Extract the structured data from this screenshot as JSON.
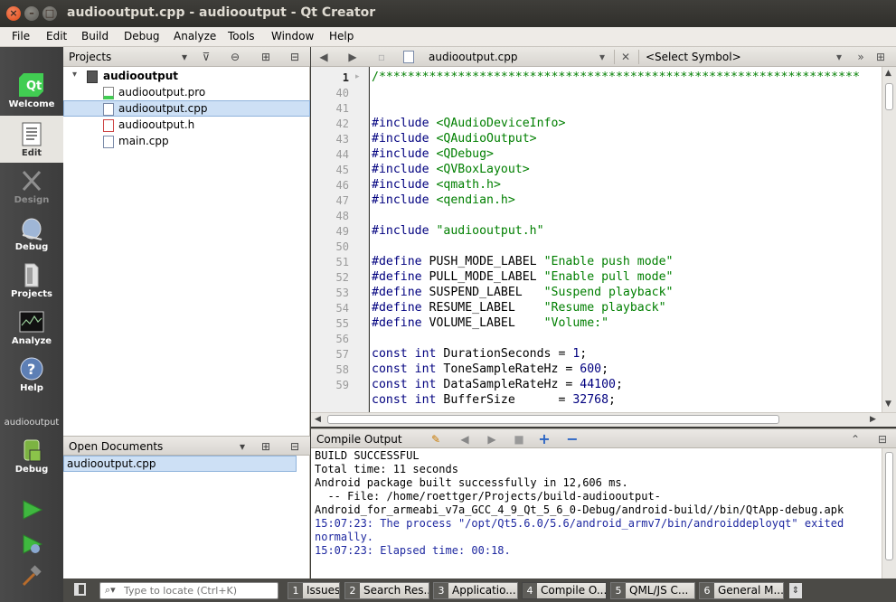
{
  "window": {
    "title": "audiooutput.cpp - audiooutput - Qt Creator",
    "close_glyph": "×",
    "minimize_glyph": "–",
    "maximize_glyph": "□"
  },
  "menu": [
    "File",
    "Edit",
    "Build",
    "Debug",
    "Analyze",
    "Tools",
    "Window",
    "Help"
  ],
  "modes": [
    {
      "label": "Welcome",
      "icon": "qt-logo-icon",
      "state": "normal"
    },
    {
      "label": "Edit",
      "icon": "edit-document-icon",
      "state": "active"
    },
    {
      "label": "Design",
      "icon": "design-icon",
      "state": "disabled"
    },
    {
      "label": "Debug",
      "icon": "debug-bug-icon",
      "state": "normal"
    },
    {
      "label": "Projects",
      "icon": "projects-icon",
      "state": "normal"
    },
    {
      "label": "Analyze",
      "icon": "analyze-icon",
      "state": "normal"
    },
    {
      "label": "Help",
      "icon": "help-icon",
      "state": "normal"
    }
  ],
  "kit": {
    "project": "audiooutput",
    "build_config": "Debug"
  },
  "projects_pane": {
    "title": "Projects",
    "root": "audiooutput",
    "files": [
      {
        "name": "audiooutput.pro",
        "type": "pro"
      },
      {
        "name": "audiooutput.cpp",
        "type": "cpp",
        "selected": true
      },
      {
        "name": "audiooutput.h",
        "type": "h"
      },
      {
        "name": "main.cpp",
        "type": "cpp"
      }
    ]
  },
  "open_documents": {
    "title": "Open Documents",
    "items": [
      "audiooutput.cpp"
    ]
  },
  "editor": {
    "file": "audiooutput.cpp",
    "symbol": "<Select Symbol>",
    "current_line": "1",
    "line_numbers": [
      "1",
      "40",
      "41",
      "42",
      "43",
      "44",
      "45",
      "46",
      "47",
      "48",
      "49",
      "50",
      "51",
      "52",
      "53",
      "54",
      "55",
      "56",
      "57",
      "58",
      "59"
    ],
    "lines": [
      [
        {
          "t": "/*******************************************************************",
          "c": "st"
        }
      ],
      [],
      [],
      [
        {
          "t": "#include ",
          "c": "pp"
        },
        {
          "t": "<QAudioDeviceInfo>",
          "c": "st"
        }
      ],
      [
        {
          "t": "#include ",
          "c": "pp"
        },
        {
          "t": "<QAudioOutput>",
          "c": "st"
        }
      ],
      [
        {
          "t": "#include ",
          "c": "pp"
        },
        {
          "t": "<QDebug>",
          "c": "st"
        }
      ],
      [
        {
          "t": "#include ",
          "c": "pp"
        },
        {
          "t": "<QVBoxLayout>",
          "c": "st"
        }
      ],
      [
        {
          "t": "#include ",
          "c": "pp"
        },
        {
          "t": "<qmath.h>",
          "c": "st"
        }
      ],
      [
        {
          "t": "#include ",
          "c": "pp"
        },
        {
          "t": "<qendian.h>",
          "c": "st"
        }
      ],
      [],
      [
        {
          "t": "#include ",
          "c": "pp"
        },
        {
          "t": "\"audiooutput.h\"",
          "c": "st"
        }
      ],
      [],
      [
        {
          "t": "#define ",
          "c": "pp"
        },
        {
          "t": "PUSH_MODE_LABEL ",
          "c": ""
        },
        {
          "t": "\"Enable push mode\"",
          "c": "st"
        }
      ],
      [
        {
          "t": "#define ",
          "c": "pp"
        },
        {
          "t": "PULL_MODE_LABEL ",
          "c": ""
        },
        {
          "t": "\"Enable pull mode\"",
          "c": "st"
        }
      ],
      [
        {
          "t": "#define ",
          "c": "pp"
        },
        {
          "t": "SUSPEND_LABEL   ",
          "c": ""
        },
        {
          "t": "\"Suspend playback\"",
          "c": "st"
        }
      ],
      [
        {
          "t": "#define ",
          "c": "pp"
        },
        {
          "t": "RESUME_LABEL    ",
          "c": ""
        },
        {
          "t": "\"Resume playback\"",
          "c": "st"
        }
      ],
      [
        {
          "t": "#define ",
          "c": "pp"
        },
        {
          "t": "VOLUME_LABEL    ",
          "c": ""
        },
        {
          "t": "\"Volume:\"",
          "c": "st"
        }
      ],
      [],
      [
        {
          "t": "const ",
          "c": "kw"
        },
        {
          "t": "int ",
          "c": "kw"
        },
        {
          "t": "DurationSeconds = ",
          "c": ""
        },
        {
          "t": "1",
          "c": "nm"
        },
        {
          "t": ";",
          "c": ""
        }
      ],
      [
        {
          "t": "const ",
          "c": "kw"
        },
        {
          "t": "int ",
          "c": "kw"
        },
        {
          "t": "ToneSampleRateHz = ",
          "c": ""
        },
        {
          "t": "600",
          "c": "nm"
        },
        {
          "t": ";",
          "c": ""
        }
      ],
      [
        {
          "t": "const ",
          "c": "kw"
        },
        {
          "t": "int ",
          "c": "kw"
        },
        {
          "t": "DataSampleRateHz = ",
          "c": ""
        },
        {
          "t": "44100",
          "c": "nm"
        },
        {
          "t": ";",
          "c": ""
        }
      ],
      [
        {
          "t": "const ",
          "c": "kw"
        },
        {
          "t": "int ",
          "c": "kw"
        },
        {
          "t": "BufferSize      = ",
          "c": ""
        },
        {
          "t": "32768",
          "c": "nm"
        },
        {
          "t": ";",
          "c": ""
        }
      ]
    ]
  },
  "output_pane": {
    "title": "Compile Output",
    "lines": [
      {
        "text": "BUILD SUCCESSFUL",
        "color": "black"
      },
      {
        "text": "Total time: 11 seconds",
        "color": "black"
      },
      {
        "text": "Android package built successfully in 12,606 ms.",
        "color": "black"
      },
      {
        "text": "  -- File: /home/roettger/Projects/build-audiooutput-",
        "color": "black"
      },
      {
        "text": "Android_for_armeabi_v7a_GCC_4_9_Qt_5_6_0-Debug/android-build//bin/QtApp-debug.apk",
        "color": "black"
      },
      {
        "text": "15:07:23: The process \"/opt/Qt5.6.0/5.6/android_armv7/bin/androiddeployqt\" exited",
        "color": "blue"
      },
      {
        "text": "normally.",
        "color": "blue"
      },
      {
        "text": "15:07:23: Elapsed time: 00:18.",
        "color": "blue"
      }
    ]
  },
  "status_bar": {
    "locator_placeholder": "Type to locate (Ctrl+K)",
    "tabs": [
      {
        "num": "1",
        "label": "Issues"
      },
      {
        "num": "2",
        "label": "Search Res..."
      },
      {
        "num": "3",
        "label": "Applicatio..."
      },
      {
        "num": "4",
        "label": "Compile O..."
      },
      {
        "num": "5",
        "label": "QML/JS C..."
      },
      {
        "num": "6",
        "label": "General M..."
      }
    ]
  },
  "colors": {
    "keyword": "#00007f",
    "string": "#007f00",
    "output_info": "#1e28a0",
    "selection": "#cde0f5"
  }
}
